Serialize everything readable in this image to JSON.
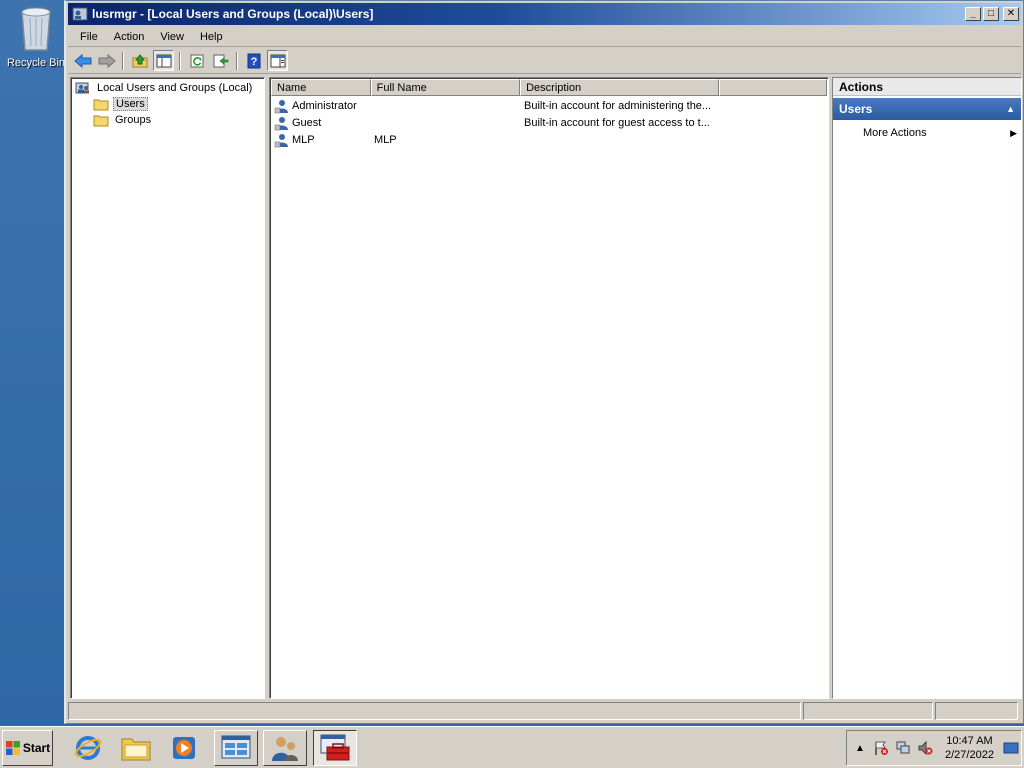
{
  "desktop": {
    "recycle_bin_label": "Recycle Bin"
  },
  "window": {
    "title": "lusrmgr - [Local Users and Groups (Local)\\Users]",
    "controls": {
      "minimize": "_",
      "maximize": "□",
      "close": "✕"
    }
  },
  "menubar": {
    "items": [
      "File",
      "Action",
      "View",
      "Help"
    ]
  },
  "toolbar": {
    "buttons": [
      "back-icon",
      "forward-icon",
      "up-one-level-icon",
      "show-hide-console-tree-icon",
      "refresh-icon",
      "export-list-icon",
      "help-icon",
      "show-hide-action-pane-icon"
    ]
  },
  "tree": {
    "root": "Local Users and Groups (Local)",
    "children": [
      "Users",
      "Groups"
    ],
    "selected": "Users"
  },
  "list": {
    "columns": [
      "Name",
      "Full Name",
      "Description"
    ],
    "rows": [
      {
        "name": "Administrator",
        "full_name": "",
        "description": "Built-in account for administering the..."
      },
      {
        "name": "Guest",
        "full_name": "",
        "description": "Built-in account for guest access to t..."
      },
      {
        "name": "MLP",
        "full_name": "MLP",
        "description": ""
      }
    ]
  },
  "actions": {
    "header": "Actions",
    "section": "Users",
    "items": [
      "More Actions"
    ]
  },
  "taskbar": {
    "start_label": "Start",
    "apps": [
      "internet-explorer-icon",
      "windows-explorer-icon",
      "windows-media-player-icon",
      "server-manager-icon",
      "users-groups-icon",
      "lusrmgr-icon"
    ],
    "tray": {
      "time": "10:47 AM",
      "date": "2/27/2022"
    }
  },
  "colors": {
    "desktop": "#3a6ea5",
    "title_gradient_start": "#0a246a",
    "action_section": "#2a5aa0"
  }
}
